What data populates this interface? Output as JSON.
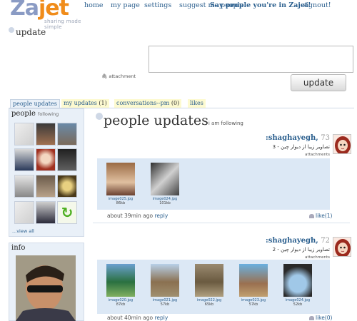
{
  "brand": {
    "logo_z": "Z",
    "logo_rest": "a",
    "logo_j": "jet",
    "tagline": "sharing made simple"
  },
  "nav": {
    "items": [
      "home",
      "my page",
      "settings",
      "suggest me people"
    ],
    "cta": "Say people you're in Zajet!",
    "signout": "signout!"
  },
  "composer": {
    "title": "update",
    "attachment_label": "attachment",
    "button_label": "update",
    "value": ""
  },
  "tabs": [
    {
      "label": "people updates",
      "count": ""
    },
    {
      "label": "my updates",
      "count": "(1)"
    },
    {
      "label": "conversations--pm",
      "count": "(0)"
    },
    {
      "label": "likes",
      "count": ""
    }
  ],
  "sidebar": {
    "people_heading": "people",
    "people_sub": "following",
    "view_all": "...view all",
    "info_heading": "info"
  },
  "main": {
    "title": "people updates",
    "title_sub": "i am following"
  },
  "entries": [
    {
      "name": ":shaghayegh,",
      "num": "73",
      "text": "تصاویر زیبا از دیوار چین - 3",
      "sub": "attachments",
      "images": [
        {
          "name": "image025.jpg",
          "size": "86kb"
        },
        {
          "name": "image024.jpg",
          "size": "101kb"
        }
      ],
      "time": "about 39min ago",
      "reply": "reply",
      "likes": "like(1)"
    },
    {
      "name": ":shaghayegh,",
      "num": "72",
      "text": "تصاویر زیبا از دیوار چین - 2",
      "sub": "attachments",
      "images": [
        {
          "name": "image020.jpg",
          "size": "87kb"
        },
        {
          "name": "image021.jpg",
          "size": "57kb"
        },
        {
          "name": "image022.jpg",
          "size": "65kb"
        },
        {
          "name": "image023.jpg",
          "size": "57kb"
        },
        {
          "name": "image024.jpg",
          "size": "52kb"
        }
      ],
      "time": "about 40min ago",
      "reply": "reply",
      "likes": "like(0)"
    }
  ],
  "colors": {
    "link": "#2b5f8e",
    "accent_orange": "#f08c1a",
    "panel": "#e9f0f8",
    "tab_yellow": "#fdfad0"
  }
}
